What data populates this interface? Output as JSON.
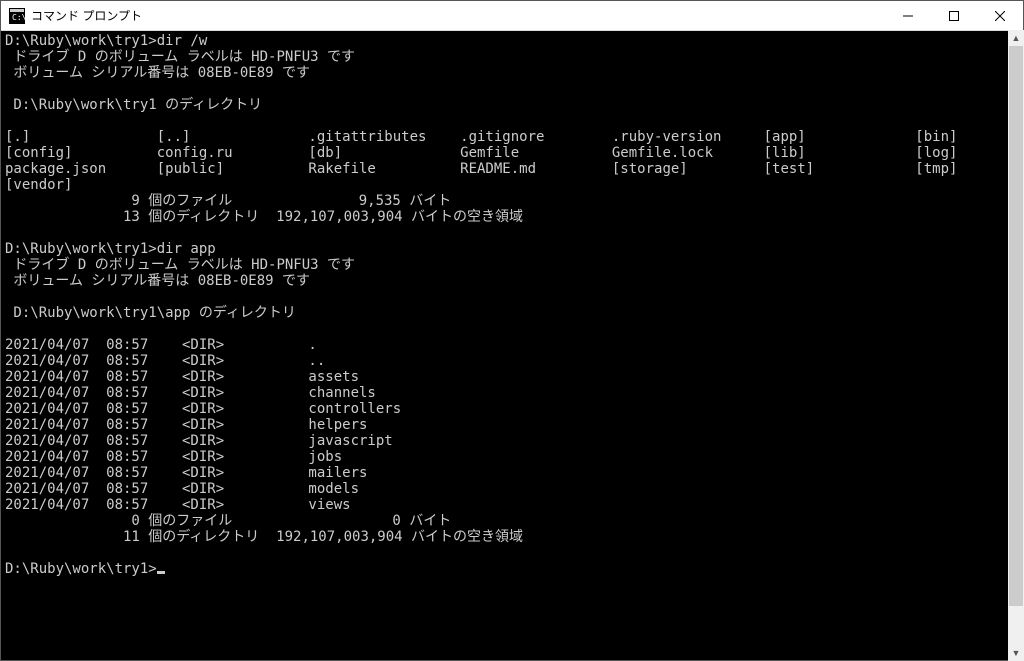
{
  "window": {
    "title": "コマンド プロンプト"
  },
  "terminal": {
    "block1": {
      "prompt": "D:\\Ruby\\work\\try1>dir /w",
      "volume_label": " ドライブ D のボリューム ラベルは HD-PNFU3 です",
      "serial": " ボリューム シリアル番号は 08EB-0E89 です",
      "blank1": "",
      "dir_of": " D:\\Ruby\\work\\try1 のディレクトリ",
      "blank2": "",
      "row1": "[.]               [..]              .gitattributes    .gitignore        .ruby-version     [app]             [bin]",
      "row2": "[config]          config.ru         [db]              Gemfile           Gemfile.lock      [lib]             [log]",
      "row3": "package.json      [public]          Rakefile          README.md         [storage]         [test]            [tmp]",
      "row4": "[vendor]",
      "files_line": "               9 個のファイル               9,535 バイト",
      "dirs_line": "              13 個のディレクトリ  192,107,003,904 バイトの空き領域",
      "blank3": ""
    },
    "block2": {
      "prompt": "D:\\Ruby\\work\\try1>dir app",
      "volume_label": " ドライブ D のボリューム ラベルは HD-PNFU3 です",
      "serial": " ボリューム シリアル番号は 08EB-0E89 です",
      "blank1": "",
      "dir_of": " D:\\Ruby\\work\\try1\\app のディレクトリ",
      "blank2": "",
      "e1": "2021/04/07  08:57    <DIR>          .",
      "e2": "2021/04/07  08:57    <DIR>          ..",
      "e3": "2021/04/07  08:57    <DIR>          assets",
      "e4": "2021/04/07  08:57    <DIR>          channels",
      "e5": "2021/04/07  08:57    <DIR>          controllers",
      "e6": "2021/04/07  08:57    <DIR>          helpers",
      "e7": "2021/04/07  08:57    <DIR>          javascript",
      "e8": "2021/04/07  08:57    <DIR>          jobs",
      "e9": "2021/04/07  08:57    <DIR>          mailers",
      "e10": "2021/04/07  08:57    <DIR>          models",
      "e11": "2021/04/07  08:57    <DIR>          views",
      "files_line": "               0 個のファイル                   0 バイト",
      "dirs_line": "              11 個のディレクトリ  192,107,003,904 バイトの空き領域",
      "blank3": ""
    },
    "final_prompt": "D:\\Ruby\\work\\try1>"
  }
}
